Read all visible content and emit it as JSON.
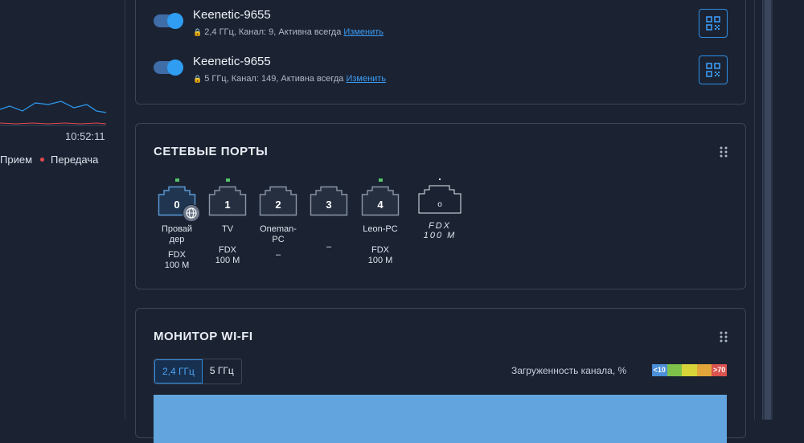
{
  "left_panel": {
    "time": "10:52:11",
    "legend_rx": "Прием",
    "legend_tx": "Передача"
  },
  "networks": [
    {
      "name": "Keenetic-9655",
      "details": "2,4 ГГц,  Канал: 9, Активна всегда",
      "edit": "Изменить",
      "enabled": true
    },
    {
      "name": "Keenetic-9655",
      "details": "5 ГГц,  Канал: 149, Активна всегда",
      "edit": "Изменить",
      "enabled": true
    }
  ],
  "ports_card": {
    "title": "СЕТЕВЫЕ ПОРТЫ",
    "ports": [
      {
        "number": "0",
        "name": "Провай\nдер",
        "speed": "FDX\n100 M",
        "link": true
      },
      {
        "number": "1",
        "name": "TV",
        "speed": "FDX\n100 M",
        "link": true
      },
      {
        "number": "2",
        "name": "Oneman-\nPC",
        "speed": "–",
        "link": false
      },
      {
        "number": "3",
        "name": "",
        "speed": "–",
        "link": false
      },
      {
        "number": "4",
        "name": "Leon-PC",
        "speed": "FDX\n100 M",
        "link": true
      },
      {
        "number": "o",
        "name": "FDX\n100 M",
        "speed": "",
        "link": false
      }
    ]
  },
  "monitor_card": {
    "title": "МОНИТОР WI-FI",
    "bands": [
      "2,4 ГГц",
      "5 ГГц"
    ],
    "selected_band": "2,4 ГГц",
    "load_label": "Загруженность канала, %",
    "scale_low": "<10",
    "scale_high": ">70",
    "scale_colors": [
      "#4a8fd8",
      "#7ec24a",
      "#d7d43a",
      "#e2a53a",
      "#d9534f"
    ]
  },
  "icons": [
    "qr-code-icon",
    "drag-grip-icon",
    "ethernet-port-icon",
    "globe-icon",
    "lock-icon"
  ],
  "colors": {
    "accent": "#2e9df2",
    "link_led": "#57c26a",
    "background": "#1b2333"
  }
}
